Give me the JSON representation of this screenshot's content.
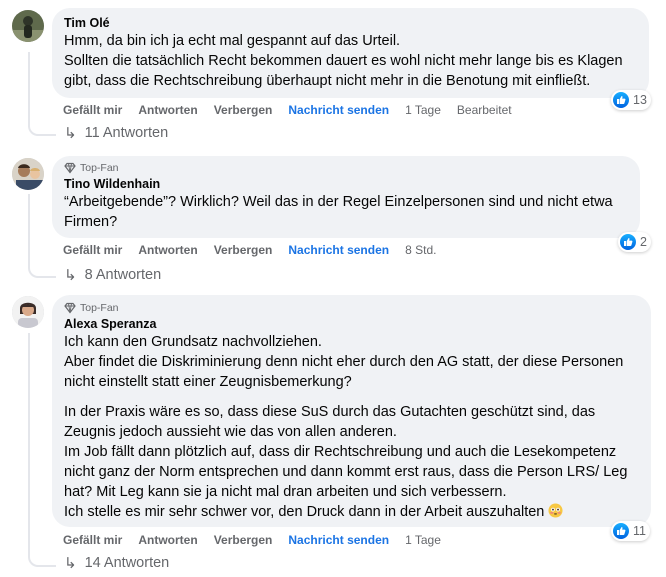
{
  "comments": [
    {
      "author": "Tim Olé",
      "top_fan": false,
      "text": [
        "Hmm, da bin ich ja echt mal gespannt auf das Urteil.",
        "Sollten die tatsächlich Recht bekommen dauert es wohl nicht mehr lange bis es Klagen gibt, dass die Rechtschreibung überhaupt nicht mehr in die Benotung mit einfließt."
      ],
      "actions": {
        "like": "Gefällt mir",
        "reply": "Antworten",
        "hide": "Verbergen",
        "send": "Nachricht senden",
        "time": "1 Tage",
        "edited": "Bearbeitet"
      },
      "reactions": "13",
      "replies": "11 Antworten"
    },
    {
      "author": "Tino Wildenhain",
      "top_fan": true,
      "badge": "Top-Fan",
      "text": [
        "“Arbeitgebende”? Wirklich? Weil das in der Regel Einzelpersonen sind und nicht etwa Firmen?"
      ],
      "actions": {
        "like": "Gefällt mir",
        "reply": "Antworten",
        "hide": "Verbergen",
        "send": "Nachricht senden",
        "time": "8 Std."
      },
      "reactions": "2",
      "replies": "8 Antworten"
    },
    {
      "author": "Alexa Speranza",
      "top_fan": true,
      "badge": "Top-Fan",
      "text": [
        "Ich kann den Grundsatz nachvollziehen.",
        "Aber findet die Diskriminierung denn nicht eher durch den AG statt, der diese Personen nicht einstellt statt einer Zeugnisbemerkung?",
        "In der Praxis wäre es so, dass diese SuS durch das Gutachten geschützt sind, das Zeugnis jedoch aussieht wie das von allen anderen.",
        "Im Job fällt dann plötzlich auf, dass dir Rechtschreibung und auch die Lesekompetenz nicht ganz der Norm entsprechen und dann kommt erst raus, dass die Person LRS/ Leg hat? Mit Leg kann sie ja nicht mal dran arbeiten und sich verbessern.",
        "Ich stelle es mir sehr schwer vor, den Druck dann in der Arbeit auszuhalten"
      ],
      "actions": {
        "like": "Gefällt mir",
        "reply": "Antworten",
        "hide": "Verbergen",
        "send": "Nachricht senden",
        "time": "1 Tage"
      },
      "reactions": "11",
      "replies": "14 Antworten"
    }
  ],
  "icons": {
    "like": "thumbs-up-icon",
    "badge": "diamond-icon",
    "reply_arrow": "reply-arrow-icon",
    "emoji": "flushed-face-emoji"
  },
  "colors": {
    "bubble": "#f0f2f5",
    "link_blue": "#1b74e4",
    "meta_gray": "#65676b",
    "like_blue": "#0866ff"
  }
}
